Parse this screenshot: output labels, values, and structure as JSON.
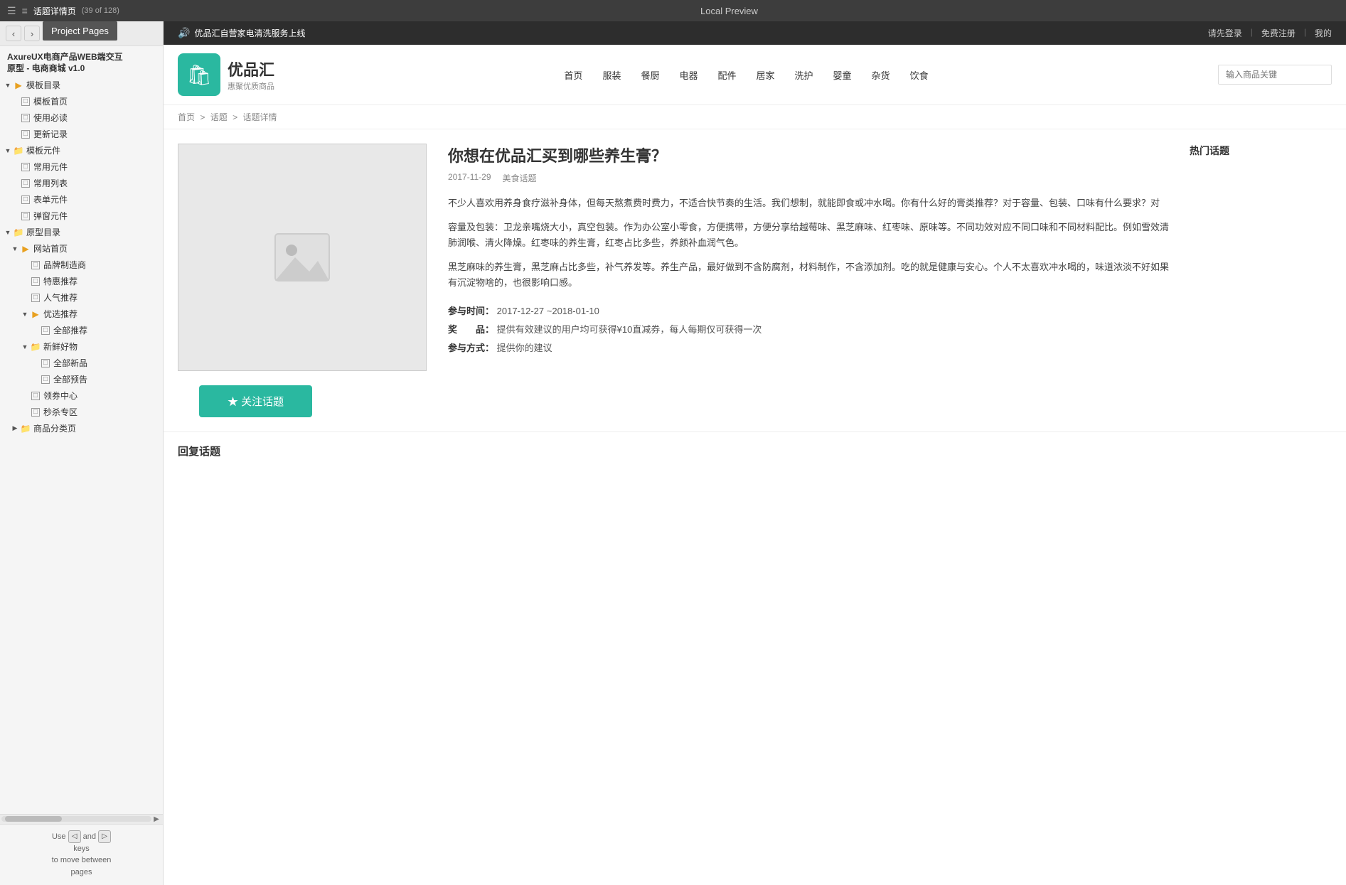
{
  "topbar": {
    "page_title": "话题详情页",
    "page_count": "(39 of 128)",
    "center_title": "Local Preview",
    "prev_label": "‹",
    "next_label": "›"
  },
  "project_pages_tooltip": "Project Pages",
  "sidebar": {
    "title_line1": "AxureUX电商产品WEB端交互",
    "title_line2": "原型 - 电商商城 v1.0",
    "sections": [
      {
        "id": "template-dir",
        "label": "模板目录",
        "indent": 0,
        "type": "folder-open",
        "expanded": true
      },
      {
        "id": "template-home",
        "label": "模板首页",
        "indent": 1,
        "type": "page"
      },
      {
        "id": "use-guide",
        "label": "使用必读",
        "indent": 1,
        "type": "page"
      },
      {
        "id": "update-log",
        "label": "更新记录",
        "indent": 1,
        "type": "page"
      },
      {
        "id": "template-comp",
        "label": "模板元件",
        "indent": 0,
        "type": "folder-blue",
        "expanded": true
      },
      {
        "id": "common-comp",
        "label": "常用元件",
        "indent": 1,
        "type": "page"
      },
      {
        "id": "common-list",
        "label": "常用列表",
        "indent": 1,
        "type": "page"
      },
      {
        "id": "form-comp",
        "label": "表单元件",
        "indent": 1,
        "type": "page"
      },
      {
        "id": "dialog-comp",
        "label": "弹窗元件",
        "indent": 1,
        "type": "page"
      },
      {
        "id": "proto-dir",
        "label": "原型目录",
        "indent": 0,
        "type": "folder-blue",
        "expanded": true
      },
      {
        "id": "website-home",
        "label": "网站首页",
        "indent": 1,
        "type": "folder-open",
        "expanded": true
      },
      {
        "id": "brand-maker",
        "label": "品牌制造商",
        "indent": 2,
        "type": "page"
      },
      {
        "id": "special-offer",
        "label": "特惠推荐",
        "indent": 2,
        "type": "page"
      },
      {
        "id": "popular-rec",
        "label": "人气推荐",
        "indent": 2,
        "type": "page"
      },
      {
        "id": "select-rec",
        "label": "优选推荐",
        "indent": 2,
        "type": "folder-open",
        "expanded": true
      },
      {
        "id": "all-rec",
        "label": "全部推荐",
        "indent": 3,
        "type": "page"
      },
      {
        "id": "fresh-goods",
        "label": "新鲜好物",
        "indent": 2,
        "type": "folder-blue",
        "expanded": true
      },
      {
        "id": "all-new",
        "label": "全部新品",
        "indent": 3,
        "type": "page"
      },
      {
        "id": "all-preview",
        "label": "全部预告",
        "indent": 3,
        "type": "page"
      },
      {
        "id": "coupon-center",
        "label": "领券中心",
        "indent": 2,
        "type": "page"
      },
      {
        "id": "flash-sale",
        "label": "秒杀专区",
        "indent": 2,
        "type": "page"
      },
      {
        "id": "category-page",
        "label": "商品分类页",
        "indent": 1,
        "type": "folder-blue",
        "expanded": false
      }
    ],
    "bottom_hint": {
      "text_before": "Use",
      "key_left": "◁",
      "text_and": "and",
      "key_right": "▷",
      "text_keys": "keys",
      "text_move": "to move between",
      "text_pages": "pages"
    }
  },
  "ecom": {
    "announcement": "优品汇自营家电清洗服务上线",
    "speaker": "🔊",
    "nav_links": {
      "login": "请先登录",
      "register": "免费注册",
      "account": "我的"
    },
    "logo": {
      "icon": "🛍",
      "name": "优品汇",
      "slogan": "惠聚优质商品"
    },
    "nav_items": [
      "首页",
      "服装",
      "餐厨",
      "电器",
      "配件",
      "居家",
      "洗护",
      "婴童",
      "杂货",
      "饮食"
    ],
    "search_placeholder": "输入商品关键",
    "breadcrumb": {
      "home": "首页",
      "sep1": ">",
      "forum": "话题",
      "sep2": ">",
      "current": "话题详情"
    },
    "topic": {
      "title": "你想在优品汇买到哪些养生膏？",
      "date": "2017-11-29",
      "category": "美食话题",
      "body1": "不少人喜欢用养身食疗滋补身体，但每天熬煮费时费力，不适合快节奏的生活。我们想制，就能即食或冲水喝。你有什么好的膏类推荐？对于容量、包装、口味有什么要求？对",
      "body2": "容量及包装：卫龙亲嘴烧大小，真空包装。作为办公室小零食，方便携带，方便分享给越莓味、黑芝麻味、红枣味、原味等。不同功效对应不同口味和不同材料配比。例如雪效清肺润喉、清火降燥。红枣味的养生膏，红枣占比多些，养颜补血润气色。",
      "body3": "黑芝麻味的养生膏，黑芝麻占比多些，补气养发等。养生产品，最好做到不含防腐剂，材料制作，不含添加剂。吃的就是健康与安心。个人不太喜欢冲水喝的，味道浓淡不好如果有沉淀物啥的，也很影响口感。",
      "participation_time_label": "参与时间：",
      "participation_time_value": "2017-12-27 ~2018-01-10",
      "prize_label": "奖　　品：",
      "prize_value": "提供有效建议的用户均可获得¥10直减券，每人每期仅可获得一次",
      "method_label": "参与方式：",
      "method_value": "提供你的建议",
      "follow_btn": "★ 关注话题",
      "reply_title": "回复话题"
    },
    "hot_topics_title": "热门话题"
  }
}
